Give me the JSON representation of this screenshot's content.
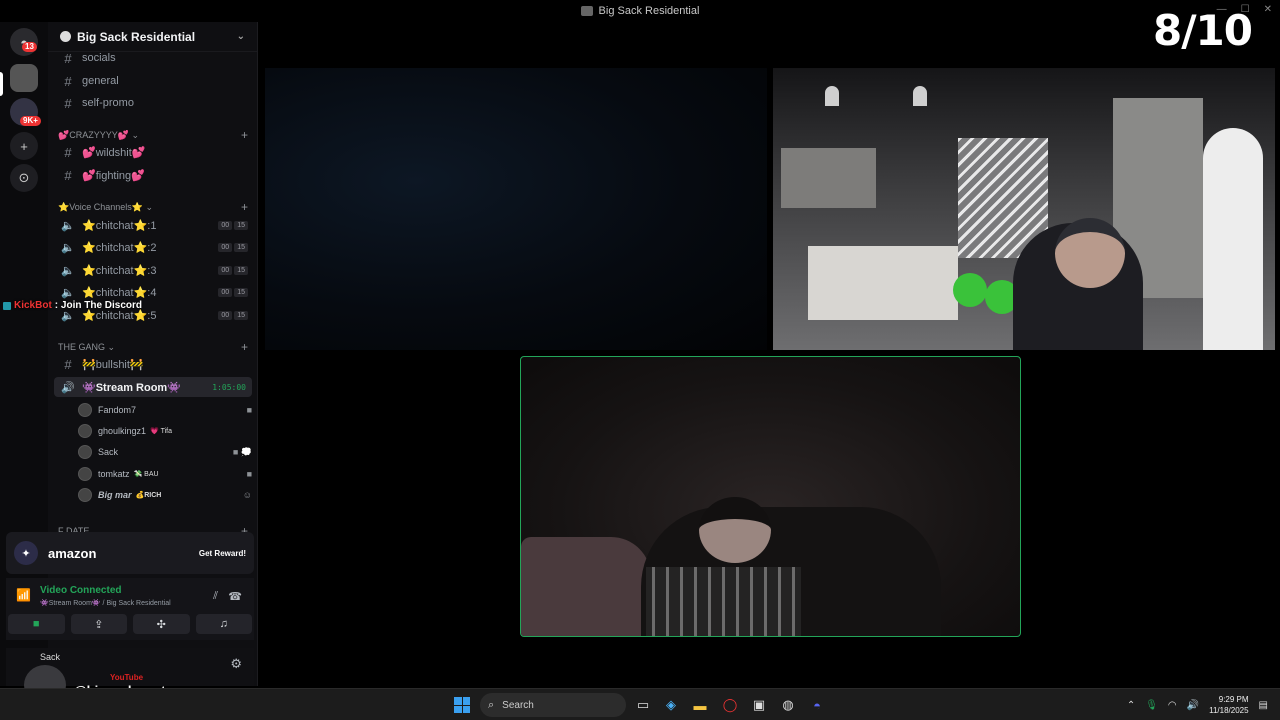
{
  "window": {
    "title": "Big Sack Residential"
  },
  "overlay": {
    "score": "8/10"
  },
  "rail": {
    "dm_badge": "13",
    "server_badge": "9K+"
  },
  "server": {
    "name": "Big Sack Residential"
  },
  "channels_top": [
    {
      "name": "socials"
    },
    {
      "name": "general"
    },
    {
      "name": "self-promo"
    }
  ],
  "cat_crazy": {
    "label": "💕CRAZYYYY💕"
  },
  "crazy_channels": [
    {
      "name": "💕wildshit💕"
    },
    {
      "name": "💕fighting💕"
    }
  ],
  "cat_voice": {
    "label": "⭐Voice Channels⭐"
  },
  "voice_channels": [
    {
      "name": "⭐chitchat⭐:1",
      "c1": "00",
      "c2": "15"
    },
    {
      "name": "⭐chitchat⭐:2",
      "c1": "00",
      "c2": "15"
    },
    {
      "name": "⭐chitchat⭐:3",
      "c1": "00",
      "c2": "15"
    },
    {
      "name": "⭐chitchat⭐:4",
      "c1": "00",
      "c2": "15"
    },
    {
      "name": "⭐chitchat⭐:5",
      "c1": "00",
      "c2": "15"
    }
  ],
  "kickbot": {
    "name": "KickBot",
    "message": ": Join The Discord"
  },
  "cat_gang": {
    "label": "THE GANG"
  },
  "gang_channels": [
    {
      "name": "🚧bullshit🚧"
    }
  ],
  "active_channel": {
    "name": "👾Stream Room👾",
    "timer": "1:05:00"
  },
  "members": [
    {
      "name": "Fandom7",
      "tag": ""
    },
    {
      "name": "ghoulkingz1",
      "tag": "💗 Tifa"
    },
    {
      "name": "Sack",
      "tag": ""
    },
    {
      "name": "tomkatz",
      "tag": "💸 BAU"
    },
    {
      "name": "Big mar",
      "tag": "💰RICH"
    }
  ],
  "cat_next": {
    "label": "F DATE"
  },
  "promo": {
    "brand": "amazon",
    "cta": "Get Reward!"
  },
  "voice": {
    "status": "Video Connected",
    "location": "👾Stream Room👾 / Big Sack Residential"
  },
  "user": {
    "name": "Sack"
  },
  "youtube": {
    "label": "YouTube",
    "handle": "@bigsackwontsags"
  },
  "taskbar": {
    "search_placeholder": "Search",
    "time": "9:29 PM",
    "date": "11/18/2025"
  },
  "colors": {
    "accent_green": "#23a559",
    "bg": "#0f0f12",
    "danger": "#e33333"
  }
}
